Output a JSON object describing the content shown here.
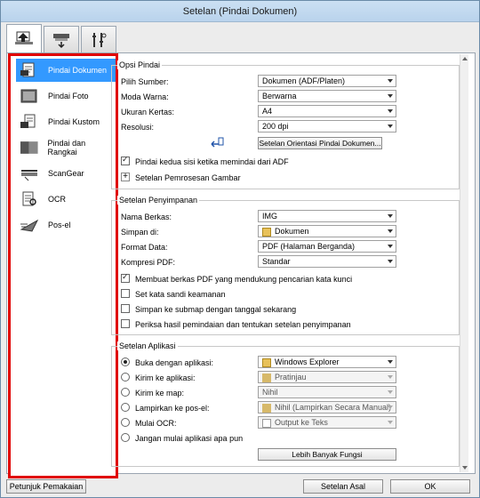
{
  "window": {
    "title": "Setelan (Pindai Dokumen)"
  },
  "tabs": [
    "scan-from-computer-icon",
    "scan-from-panel-icon",
    "general-settings-icon"
  ],
  "sidebar": {
    "items": [
      {
        "label": "Pindai Dokumen",
        "icon": "document-scan-icon"
      },
      {
        "label": "Pindai Foto",
        "icon": "photo-scan-icon"
      },
      {
        "label": "Pindai Kustom",
        "icon": "custom-scan-icon"
      },
      {
        "label": "Pindai dan Rangkai",
        "icon": "scan-stitch-icon"
      },
      {
        "label": "ScanGear",
        "icon": "scangear-icon"
      },
      {
        "label": "OCR",
        "icon": "ocr-icon"
      },
      {
        "label": "Pos-el",
        "icon": "email-icon"
      }
    ]
  },
  "scan_options": {
    "title": "Opsi Pindai",
    "source_label": "Pilih Sumber:",
    "source_value": "Dokumen (ADF/Platen)",
    "color_label": "Moda Warna:",
    "color_value": "Berwarna",
    "paper_label": "Ukuran Kertas:",
    "paper_value": "A4",
    "resolution_label": "Resolusi:",
    "resolution_value": "200 dpi",
    "orientation_button": "Setelan Orientasi Pindai Dokumen...",
    "duplex_label": "Pindai kedua sisi ketika memindai dari ADF",
    "image_processing_label": "Setelan Pemrosesan Gambar"
  },
  "save_settings": {
    "title": "Setelan Penyimpanan",
    "filename_label": "Nama Berkas:",
    "filename_value": "IMG",
    "save_in_label": "Simpan di:",
    "save_in_value": "Dokumen",
    "format_label": "Format Data:",
    "format_value": "PDF (Halaman Berganda)",
    "compression_label": "Kompresi PDF:",
    "compression_value": "Standar",
    "searchable_label": "Membuat berkas PDF yang mendukung pencarian kata kunci",
    "password_label": "Set kata sandi keamanan",
    "subfolder_label": "Simpan ke submap dengan tanggal sekarang",
    "check_results_label": "Periksa hasil pemindaian dan tentukan setelan penyimpanan"
  },
  "app_settings": {
    "title": "Setelan Aplikasi",
    "open_app_label": "Buka dengan aplikasi:",
    "open_app_value": "Windows Explorer",
    "send_app_label": "Kirim ke aplikasi:",
    "send_app_value": "Pratinjau",
    "send_folder_label": "Kirim ke map:",
    "send_folder_value": "Nihil",
    "attach_email_label": "Lampirkan ke pos-el:",
    "attach_email_value": "Nihil (Lampirkan Secara Manual)",
    "ocr_label": "Mulai OCR:",
    "ocr_value": "Output ke Teks",
    "none_label": "Jangan mulai aplikasi apa pun",
    "more_button": "Lebih Banyak Fungsi"
  },
  "footer": {
    "instructions_button": "Petunjuk Pemakaian",
    "defaults_button": "Setelan Asal",
    "ok_button": "OK"
  },
  "colors": {
    "highlight": "#e00000",
    "selection": "#3399ff"
  }
}
